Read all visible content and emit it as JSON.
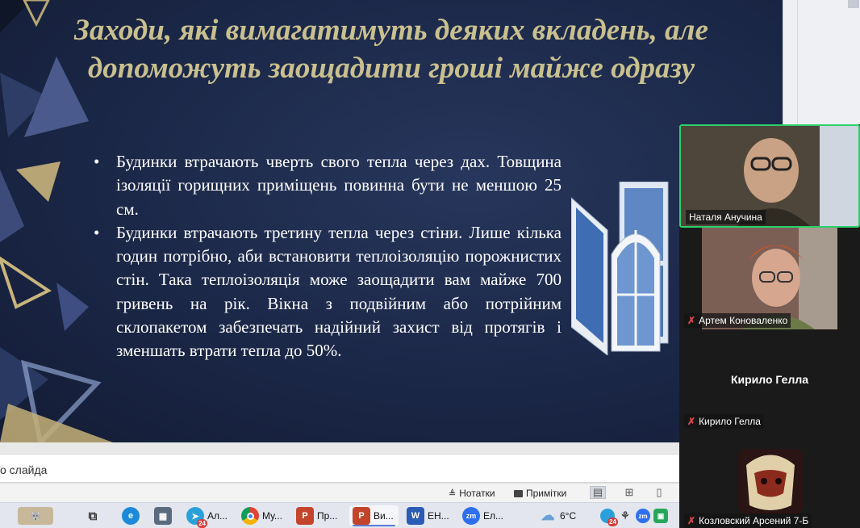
{
  "slide": {
    "title": "Заходи, які вимагатимуть деяких вкладень, але допоможуть заощадити гроші майже одразу",
    "bullets": [
      "Будинки втрачають чверть свого тепла через дах. Товщина ізоляції горищних приміщень повинна бути не меншою 25 см.",
      "Будинки втрачають третину тепла через стіни. Лише кілька годин потрібно, аби встановити теплоізоляцію порожнистих стін. Така теплоізоляція може заощадити вам майже 700 гривень на рік. Вікна з подвійним або потрійним склопакетом забезпечать надійний захист від протягів і зменшать втрати тепла до 50%."
    ]
  },
  "notes": {
    "placeholder_fragment": "о слайда"
  },
  "status_bar": {
    "notes_label": "Нотатки",
    "comments_label": "Примітки",
    "view_icons": [
      "normal-view-icon",
      "slide-sorter-icon",
      "reading-view-icon"
    ]
  },
  "taskbar": {
    "items": [
      {
        "icon": "wolf-wallpaper-icon",
        "label": ""
      },
      {
        "icon": "task-view-icon",
        "label": ""
      },
      {
        "icon": "edge-icon",
        "label": ""
      },
      {
        "icon": "calculator-icon",
        "label": ""
      },
      {
        "icon": "telegram-icon",
        "label": "Ал...",
        "badge": "24"
      },
      {
        "icon": "chrome-icon",
        "label": "Му..."
      },
      {
        "icon": "powerpoint-icon",
        "label": "Пр..."
      },
      {
        "icon": "powerpoint-icon",
        "label": "Ви..."
      },
      {
        "icon": "word-icon",
        "label": "ЕН..."
      },
      {
        "icon": "zoom-icon",
        "label": "Ел..."
      }
    ],
    "weather": "6°C",
    "tray_badge": "24",
    "colors": {
      "telegram": "#2aa0da",
      "powerpoint": "#c4442b",
      "word": "#2b5bb5",
      "zoom": "#2d6ff0",
      "edge": "#1c8ad8"
    }
  },
  "participants": [
    {
      "name": "Наталя Анучина",
      "muted": false,
      "video": true,
      "active_speaker": true
    },
    {
      "name": "Артем Коноваленко",
      "muted": true,
      "video": true
    },
    {
      "name": "Кирило Гелла",
      "muted": true,
      "video": false
    },
    {
      "name": "Козловский Арсений 7-Б",
      "muted": true,
      "video": true
    }
  ],
  "colors": {
    "slide_title": "#c9c08f",
    "slide_text": "#ffffff",
    "slide_bg": "#1b2747",
    "active_speaker_border": "#2bd16b",
    "mic_off": "#e04848"
  }
}
